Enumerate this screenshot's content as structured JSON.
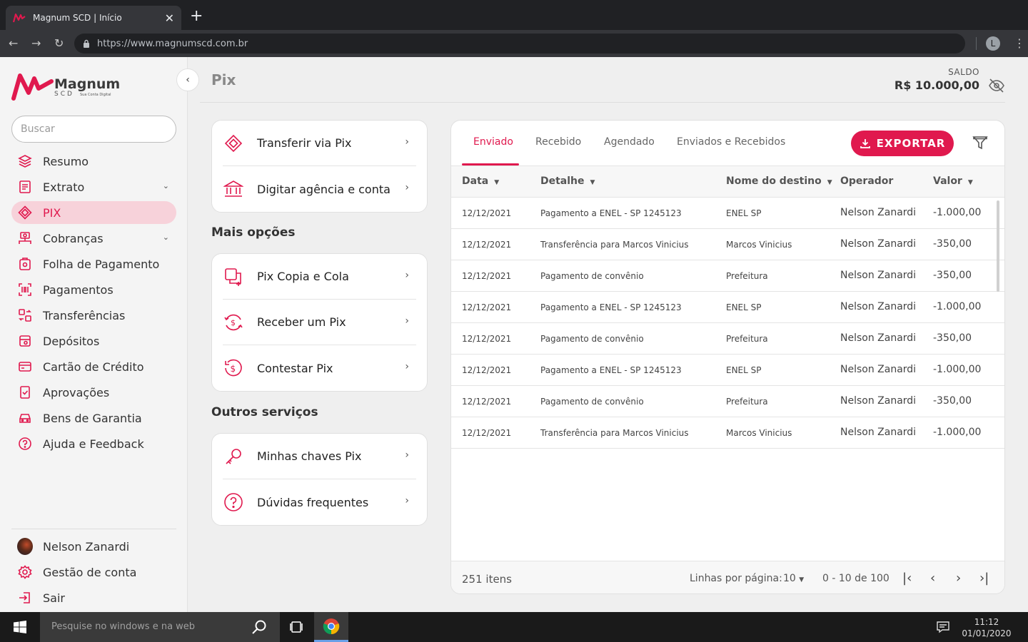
{
  "browser": {
    "tab_title": "Magnum SCD  |  Início",
    "url": "https://www.magnumscd.com.br",
    "profile_initial": "L"
  },
  "brand": {
    "name": "Magnum",
    "sub": "SCD",
    "tagline": "Sua Conta Digital",
    "accent": "#e0194e"
  },
  "sidebar": {
    "search_placeholder": "Buscar",
    "items": [
      {
        "label": "Resumo",
        "icon": "layers-icon"
      },
      {
        "label": "Extrato",
        "icon": "statement-icon"
      },
      {
        "label": "PIX",
        "icon": "pix-icon"
      },
      {
        "label": "Cobranças",
        "icon": "billing-icon"
      },
      {
        "label": "Folha de Pagamento",
        "icon": "payroll-icon"
      },
      {
        "label": "Pagamentos",
        "icon": "barcode-icon"
      },
      {
        "label": "Transferências",
        "icon": "transfer-icon"
      },
      {
        "label": "Depósitos",
        "icon": "deposit-icon"
      },
      {
        "label": "Cartão de Crédito",
        "icon": "credit-card-icon"
      },
      {
        "label": "Aprovações",
        "icon": "approval-icon"
      },
      {
        "label": "Bens de Garantia",
        "icon": "car-icon"
      },
      {
        "label": "Ajuda e Feedback",
        "icon": "help-icon"
      }
    ],
    "bottom": {
      "user_name": "Nelson Zanardi",
      "account": "Gestão de conta",
      "logout": "Sair"
    }
  },
  "header": {
    "title": "Pix",
    "saldo_label": "SALDO",
    "saldo_value": "R$ 10.000,00"
  },
  "cards": {
    "main": [
      {
        "label": "Transferir via Pix"
      },
      {
        "label": "Digitar agência e conta"
      }
    ],
    "mais_title": "Mais opções",
    "mais": [
      {
        "label": "Pix Copia e Cola"
      },
      {
        "label": "Receber um Pix"
      },
      {
        "label": "Contestar Pix"
      }
    ],
    "outros_title": "Outros serviços",
    "outros": [
      {
        "label": "Minhas chaves Pix"
      },
      {
        "label": "Dúvidas frequentes"
      }
    ]
  },
  "table": {
    "tabs": [
      "Enviado",
      "Recebido",
      "Agendado",
      "Enviados e Recebidos"
    ],
    "export_label": "EXPORTAR",
    "columns": [
      "Data",
      "Detalhe",
      "Nome do destino",
      "Operador",
      "Valor"
    ],
    "rows": [
      {
        "data": "12/12/2021",
        "detalhe": "Pagamento a ENEL - SP 1245123",
        "destino": "ENEL SP",
        "operador": "Nelson Zanardi",
        "valor": "-1.000,00"
      },
      {
        "data": "12/12/2021",
        "detalhe": "Transferência para Marcos Vinicius",
        "destino": "Marcos Vinicius",
        "operador": "Nelson Zanardi",
        "valor": "-350,00"
      },
      {
        "data": "12/12/2021",
        "detalhe": "Pagamento de convênio",
        "destino": "Prefeitura",
        "operador": "Nelson Zanardi",
        "valor": "-350,00"
      },
      {
        "data": "12/12/2021",
        "detalhe": "Pagamento a ENEL - SP 1245123",
        "destino": "ENEL SP",
        "operador": "Nelson Zanardi",
        "valor": "-1.000,00"
      },
      {
        "data": "12/12/2021",
        "detalhe": "Pagamento de convênio",
        "destino": "Prefeitura",
        "operador": "Nelson Zanardi",
        "valor": "-350,00"
      },
      {
        "data": "12/12/2021",
        "detalhe": "Pagamento a ENEL - SP 1245123",
        "destino": "ENEL SP",
        "operador": "Nelson Zanardi",
        "valor": "-1.000,00"
      },
      {
        "data": "12/12/2021",
        "detalhe": "Pagamento de convênio",
        "destino": "Prefeitura",
        "operador": "Nelson Zanardi",
        "valor": "-350,00"
      },
      {
        "data": "12/12/2021",
        "detalhe": "Transferência para Marcos Vinicius",
        "destino": "Marcos Vinicius",
        "operador": "Nelson Zanardi",
        "valor": "-1.000,00"
      }
    ],
    "footer": {
      "count": "251 itens",
      "rows_label": "Linhas por página:",
      "rows_value": "10",
      "range": "0 - 10 de 100"
    }
  },
  "taskbar": {
    "search_placeholder": "Pesquise no windows e na web",
    "time": "11:12",
    "date": "01/01/2020"
  }
}
